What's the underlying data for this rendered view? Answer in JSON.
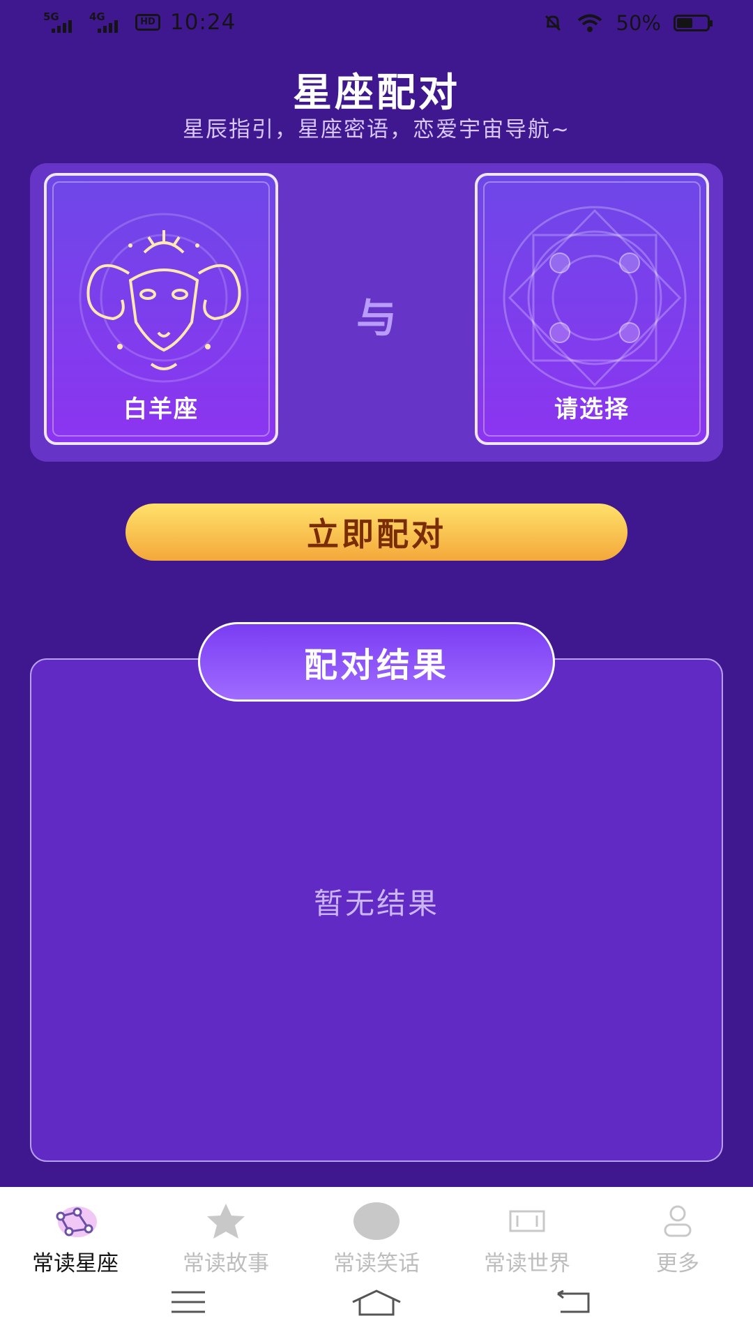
{
  "status_bar": {
    "net1": "5G",
    "net2": "4G",
    "hd": "HD",
    "time": "10:24",
    "battery": "50%"
  },
  "header": {
    "title": "星座配对",
    "subtitle": "星辰指引，星座密语，恋爱宇宙导航~"
  },
  "pairing": {
    "left_card_label": "白羊座",
    "connector": "与",
    "right_card_label": "请选择"
  },
  "match_button": "立即配对",
  "result": {
    "header": "配对结果",
    "empty": "暂无结果"
  },
  "bottom_nav": {
    "items": [
      {
        "label": "常读星座",
        "icon": "constellation-icon",
        "active": true
      },
      {
        "label": "常读故事",
        "icon": "star-icon",
        "active": false
      },
      {
        "label": "常读笑话",
        "icon": "bubble-icon",
        "active": false
      },
      {
        "label": "常读世界",
        "icon": "scroll-icon",
        "active": false
      },
      {
        "label": "更多",
        "icon": "user-icon",
        "active": false
      }
    ]
  },
  "colors": {
    "background": "#3f1890",
    "accent_gold": "#f4a83a",
    "panel": "#622ac4"
  }
}
